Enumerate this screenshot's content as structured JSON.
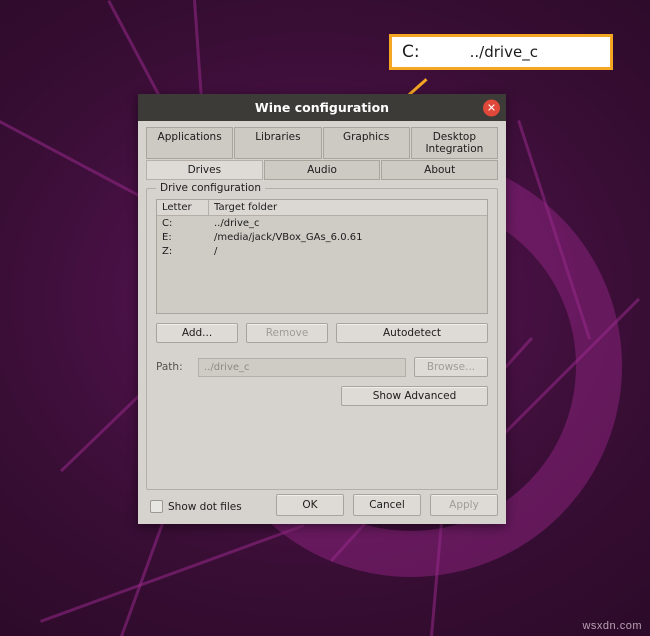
{
  "callout": {
    "drive_letter": "C:",
    "path": "../drive_c"
  },
  "window": {
    "title": "Wine configuration",
    "close_icon": "close-icon"
  },
  "tabs_row1": [
    {
      "label": "Applications",
      "selected": false
    },
    {
      "label": "Libraries",
      "selected": false
    },
    {
      "label": "Graphics",
      "selected": false
    },
    {
      "label": "Desktop Integration",
      "selected": false
    }
  ],
  "tabs_row2": [
    {
      "label": "Drives",
      "selected": true
    },
    {
      "label": "Audio",
      "selected": false
    },
    {
      "label": "About",
      "selected": false
    }
  ],
  "drive_config": {
    "group_title": "Drive configuration",
    "columns": [
      "Letter",
      "Target folder"
    ],
    "rows": [
      {
        "letter": "C:",
        "folder": "../drive_c"
      },
      {
        "letter": "E:",
        "folder": "/media/jack/VBox_GAs_6.0.61"
      },
      {
        "letter": "Z:",
        "folder": "/"
      }
    ],
    "buttons": {
      "add": "Add...",
      "remove": "Remove",
      "autodetect": "Autodetect"
    },
    "path_label": "Path:",
    "path_value": "../drive_c",
    "browse": "Browse...",
    "show_advanced": "Show Advanced"
  },
  "show_dot_files": {
    "label": "Show dot files",
    "checked": false
  },
  "footer": {
    "ok": "OK",
    "cancel": "Cancel",
    "apply": "Apply"
  },
  "watermark": "wsxdn.com",
  "colors": {
    "accent": "#f5a623",
    "close": "#e0483a",
    "titlebar": "#3c3b37",
    "window": "#d6d3ce"
  }
}
